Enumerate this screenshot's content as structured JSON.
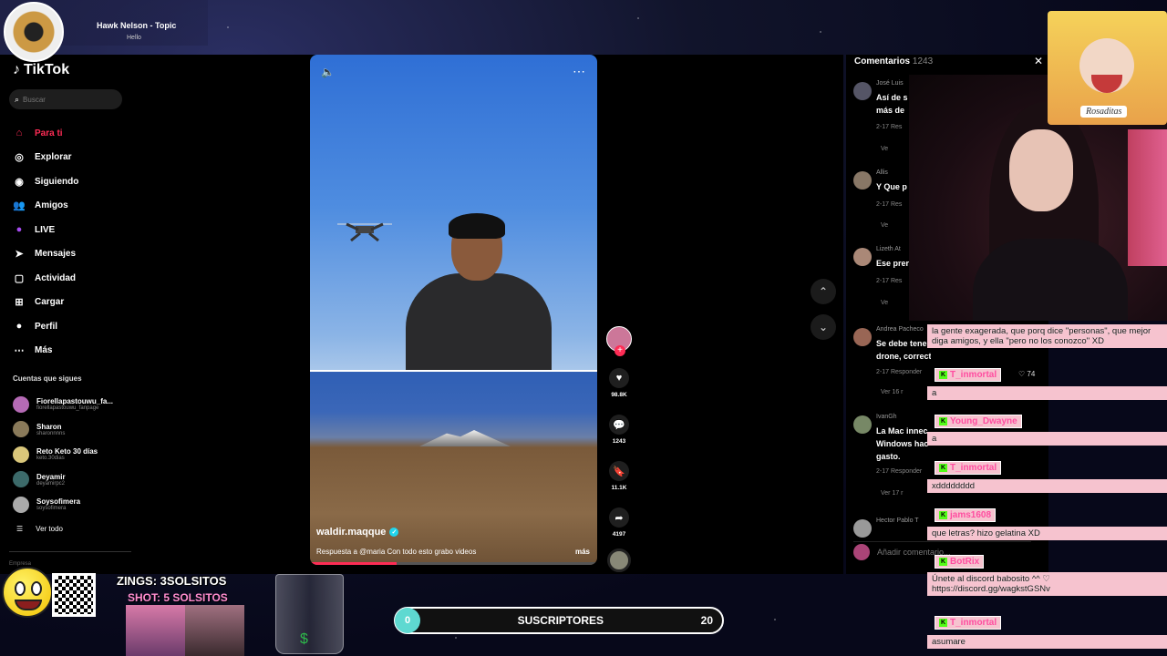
{
  "now_playing": {
    "title": "Hawk Nelson - Topic",
    "subtitle": "Hello"
  },
  "tiktok": {
    "logo": "TikTok",
    "search_placeholder": "Buscar",
    "nav": [
      {
        "label": "Para ti",
        "icon": "home-icon"
      },
      {
        "label": "Explorar",
        "icon": "compass-icon"
      },
      {
        "label": "Siguiendo",
        "icon": "following-icon"
      },
      {
        "label": "Amigos",
        "icon": "friends-icon"
      },
      {
        "label": "LIVE",
        "icon": "live-icon"
      },
      {
        "label": "Mensajes",
        "icon": "message-icon"
      },
      {
        "label": "Actividad",
        "icon": "activity-icon"
      },
      {
        "label": "Cargar",
        "icon": "upload-icon"
      },
      {
        "label": "Perfil",
        "icon": "profile-icon"
      },
      {
        "label": "Más",
        "icon": "more-icon"
      }
    ],
    "following_title": "Cuentas que sigues",
    "following": [
      {
        "name": "Fiorellapastouwu_fa...",
        "handle": "fiorellapastouwu_fanpage"
      },
      {
        "name": "Sharon",
        "handle": "sharonnnns"
      },
      {
        "name": "Reto Keto 30 días",
        "handle": "keto.30dias"
      },
      {
        "name": "Deyamir",
        "handle": "deyamirpc2"
      },
      {
        "name": "Soysofimera",
        "handle": "soysofimera"
      }
    ],
    "see_all": "Ver todo",
    "footer": "Empresa"
  },
  "video": {
    "author": "waldir.maqque",
    "caption": "Respuesta a @maria  Con todo esto grabo videos",
    "more": "más",
    "progress": 0.3
  },
  "actions": {
    "likes": "98.8K",
    "comments": "1243",
    "saves": "11.1K",
    "shares": "4197"
  },
  "comments": {
    "title": "Comentarios",
    "count": "1243",
    "input_placeholder": "Añadir comentario...",
    "items": [
      {
        "name": "José Luis",
        "text": "Así de s",
        "text2": "más de",
        "meta": "2-17  Res",
        "view": "Ve"
      },
      {
        "name": "Allis",
        "text": "Y Que p",
        "meta": "2-17  Res",
        "view": "Ve"
      },
      {
        "name": "Lizeth At",
        "text": "Ese prer",
        "meta": "2-17  Res",
        "view": "Ve"
      },
      {
        "name": "Andrea Pacheco",
        "text": "Se debe tene",
        "text2": "drone, correcto",
        "meta": "2-17  Responder",
        "view": "Ver 16 r"
      },
      {
        "name": "IvanGh",
        "text": "La Mac innec",
        "text2": "Windows hac",
        "text3": "gasto.",
        "meta": "2-17  Responder",
        "view": "Ver 17 r"
      },
      {
        "name": "Hector Pablo T",
        "text": "",
        "meta": "",
        "view": ""
      }
    ]
  },
  "sticker_label": "Rosaditas",
  "chat": [
    {
      "user": "",
      "text": "la gente exagerada, que porq dice \"personas\", que mejor diga amigos, y ella \"pero no los conozco\" XD"
    },
    {
      "user": "T_inmortal",
      "text": "a",
      "likes": "♡ 74"
    },
    {
      "user": "Young_Dwayne",
      "text": "a"
    },
    {
      "user": "T_inmortal",
      "text": "xdddddddd"
    },
    {
      "user": "jams1608",
      "text": "que letras? hizo gelatina XD"
    },
    {
      "user": "BotRix",
      "text": "Únete al discord babosito ^^ ♡ https://discord.gg/wagkstGSNv"
    },
    {
      "user": "T_inmortal",
      "text": "asumare"
    }
  ],
  "overlay": {
    "zings": "ZINGS: 3SOLSITOS",
    "shot": "SHOT: 5 SOLSITOS",
    "sub_count": "0",
    "sub_label": "SUSCRIPTORES",
    "sub_goal": "20"
  }
}
